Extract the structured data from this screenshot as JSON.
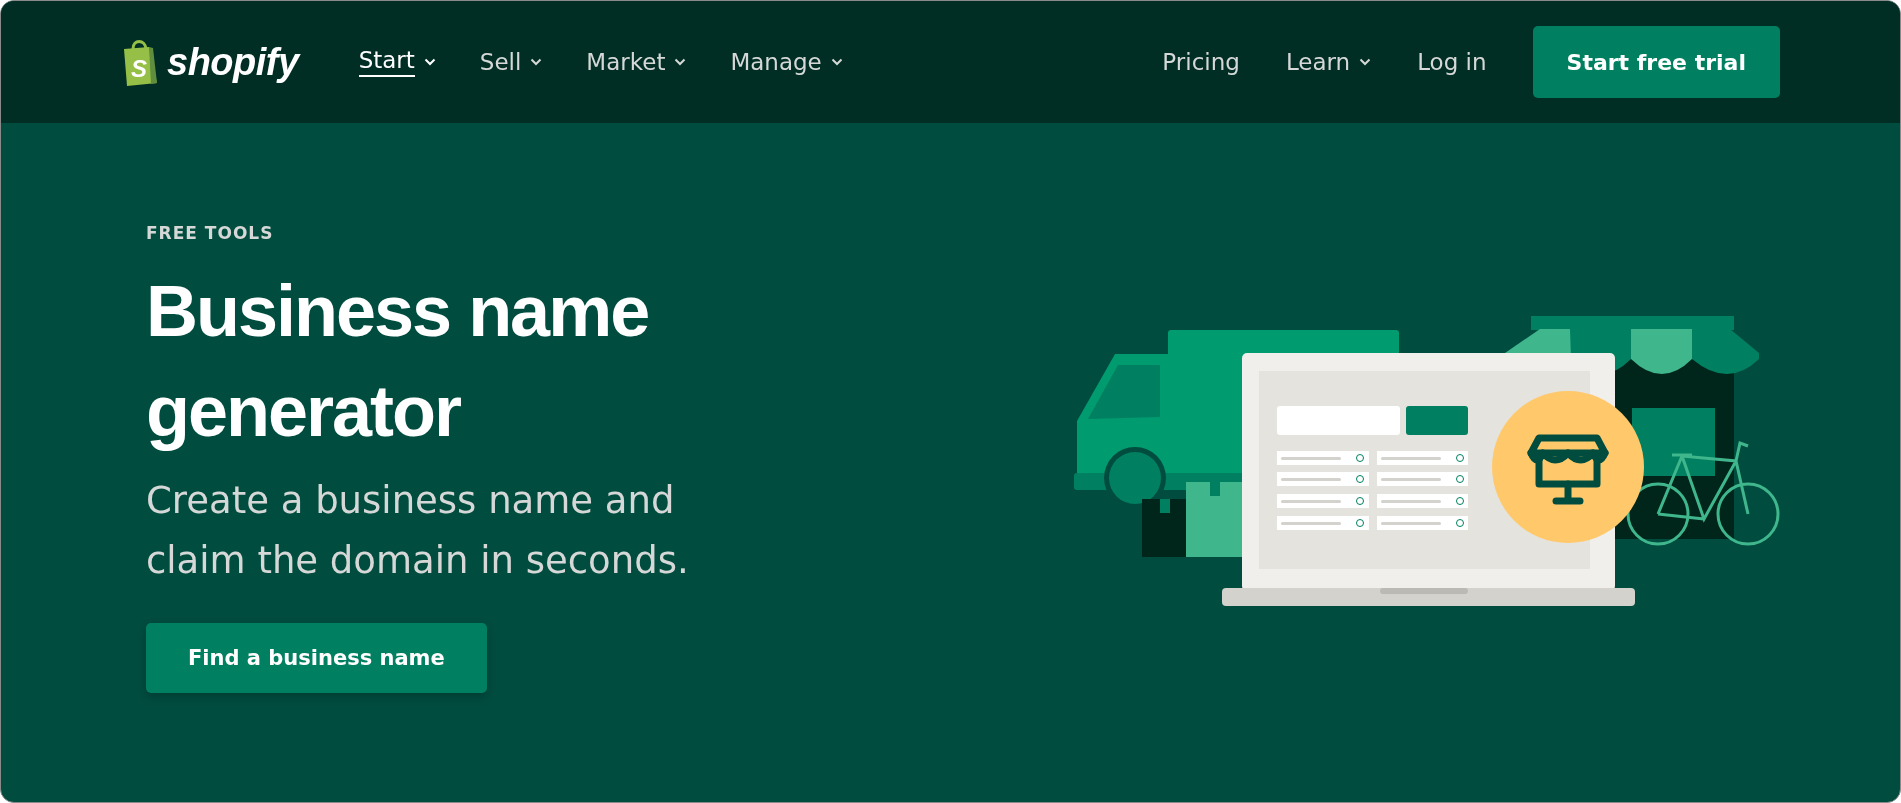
{
  "header": {
    "logo": {
      "mark": "S",
      "wordmark": "shopify"
    },
    "nav": [
      {
        "label": "Start",
        "selected": true,
        "dropdown": true
      },
      {
        "label": "Sell",
        "selected": false,
        "dropdown": true
      },
      {
        "label": "Market",
        "selected": false,
        "dropdown": true
      },
      {
        "label": "Manage",
        "selected": false,
        "dropdown": true
      }
    ],
    "right_nav": [
      {
        "label": "Pricing",
        "dropdown": false
      },
      {
        "label": "Learn",
        "dropdown": true
      },
      {
        "label": "Log in",
        "dropdown": false
      }
    ],
    "cta": "Start free trial"
  },
  "hero": {
    "eyebrow": "FREE TOOLS",
    "title": "Business name generator",
    "subtitle": "Create a business name and claim the domain in seconds.",
    "button": "Find a business name"
  }
}
